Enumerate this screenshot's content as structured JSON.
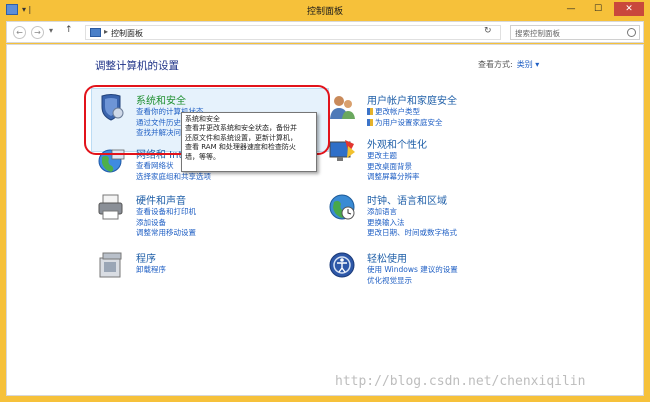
{
  "window": {
    "title": "控制面板",
    "qa_sep": "▾ |",
    "minimize": "—",
    "maximize": "☐",
    "close": "✕"
  },
  "nav": {
    "back": "←",
    "forward": "→",
    "dropdown": "▾",
    "up": "↑",
    "breadcrumb_arrow": "▸",
    "breadcrumb": "控制面板",
    "refresh": "↻",
    "search_placeholder": "搜索控制面板"
  },
  "main": {
    "heading": "调整计算机的设置",
    "view_by_label": "查看方式:",
    "view_by_value": "类别 ▾"
  },
  "categories": [
    {
      "title": "系统和安全",
      "links": [
        "查看你的计算机状态",
        "通过文件历史",
        "查找并解决问"
      ]
    },
    {
      "title": "网络和 Internet",
      "links": [
        "查看网络状",
        "选择家庭组和共享选项"
      ]
    },
    {
      "title": "硬件和声音",
      "links": [
        "查看设备和打印机",
        "添加设备",
        "调整常用移动设置"
      ]
    },
    {
      "title": "程序",
      "links": [
        "卸载程序"
      ]
    },
    {
      "title": "用户帐户和家庭安全",
      "links": [
        "更改帐户类型",
        "为用户设置家庭安全"
      ]
    },
    {
      "title": "外观和个性化",
      "links": [
        "更改主题",
        "更改桌面背景",
        "调整屏幕分辨率"
      ]
    },
    {
      "title": "时钟、语言和区域",
      "links": [
        "添加语言",
        "更换输入法",
        "更改日期、时间或数字格式"
      ]
    },
    {
      "title": "轻松使用",
      "links": [
        "使用 Windows 建议的设置",
        "优化视觉显示"
      ]
    }
  ],
  "tooltip": {
    "title": "系统和安全",
    "body": "查看并更改系统和安全状态，备份并\n还原文件和系统设置，更新计算机，\n查看 RAM 和处理器速度和检查防火\n墙，等等。"
  },
  "watermark": "http://blog.csdn.net/chenxiqilin"
}
